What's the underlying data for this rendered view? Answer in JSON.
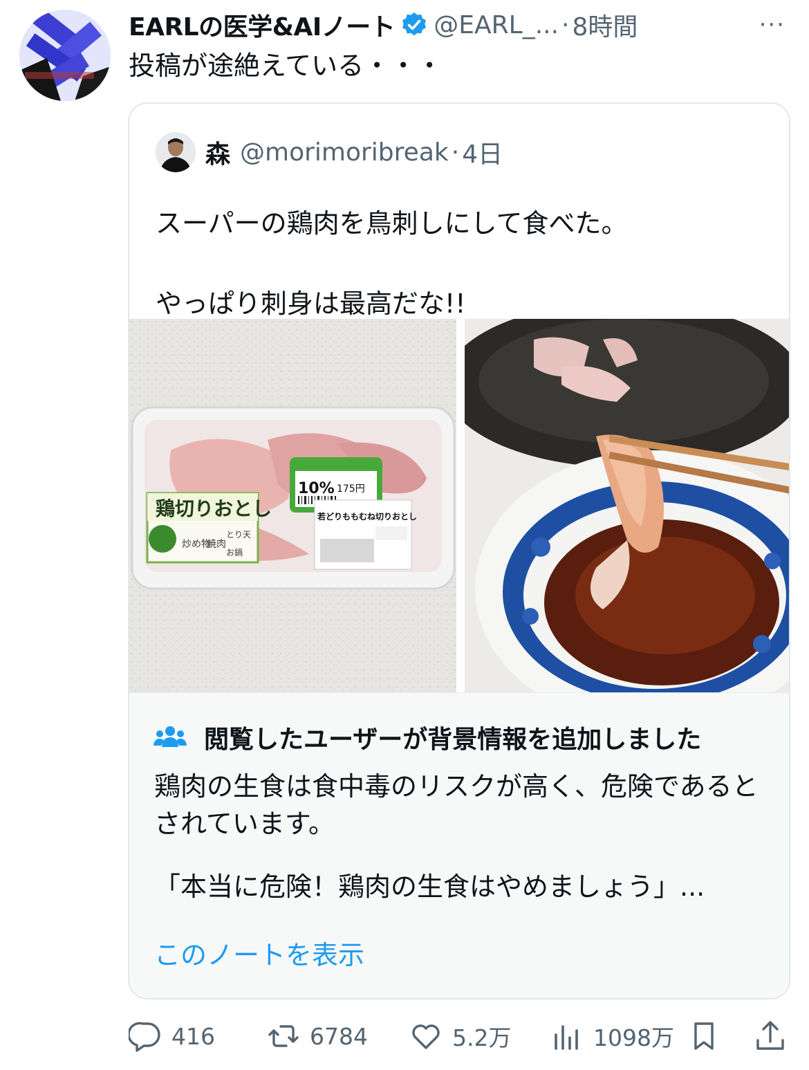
{
  "post": {
    "author_name": "EARLの医学&AIノート",
    "author_handle": "@EARL_...",
    "separator": "·",
    "time": "8時間",
    "more": "···",
    "text": "投稿が途絶えている・・・"
  },
  "quoted": {
    "name": "森",
    "handle": "@morimoribreak",
    "separator": "·",
    "time": "4日",
    "text": "スーパーの鶏肉を鳥刺しにして食べた。\n\nやっぱり刺身は最高だな!!",
    "photo1_label_main": "鶏切りおとし",
    "photo1_label_sub": [
      "炒め物",
      "焼肉",
      "とり天",
      "お鍋"
    ],
    "photo1_badge": "10%",
    "photo1_price": "175円",
    "photo1_product": "若どりももむね切りおとし"
  },
  "note": {
    "title": "閲覧したユーザーが背景情報を追加しました",
    "body": "鶏肉の生食は食中毒のリスクが高く、危険であるとされています。",
    "link_text": "「本当に危険！鶏肉の生食はやめましょう」...",
    "show_note": "このノートを表示"
  },
  "actions": {
    "replies": "416",
    "reposts": "6784",
    "likes": "5.2万",
    "views": "1098万"
  },
  "colors": {
    "accent": "#1d9bf0",
    "muted": "#536471",
    "note_bg": "#f7f9f9"
  },
  "icons": [
    "verified-badge-icon",
    "users-icon",
    "reply-icon",
    "repost-icon",
    "like-icon",
    "views-icon",
    "bookmark-icon",
    "share-icon"
  ]
}
